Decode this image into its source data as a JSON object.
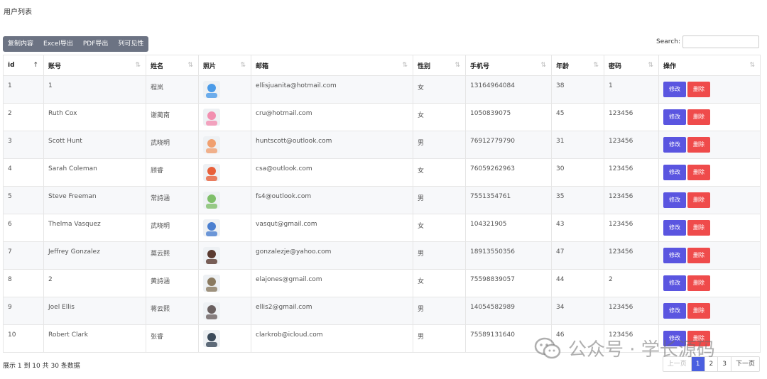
{
  "page": {
    "title": "用户列表"
  },
  "toolbar": {
    "buttons": [
      "复制内容",
      "Excel导出",
      "PDF导出",
      "列可见性"
    ]
  },
  "search": {
    "label": "Search:",
    "value": ""
  },
  "table": {
    "columns": [
      "id",
      "账号",
      "姓名",
      "照片",
      "邮箱",
      "性别",
      "手机号",
      "年龄",
      "密码",
      "操作"
    ],
    "edit_label": "修改",
    "delete_label": "删除",
    "rows": [
      {
        "id": "1",
        "account": "1",
        "name": "程岚",
        "email": "ellisjuanita@hotmail.com",
        "gender": "女",
        "phone": "13164964084",
        "age": "38",
        "password": "1",
        "avatar_color": "#4b9be8"
      },
      {
        "id": "2",
        "account": "Ruth Cox",
        "name": "谢蔺南",
        "email": "cru@hotmail.com",
        "gender": "女",
        "phone": "1050839075",
        "age": "45",
        "password": "123456",
        "avatar_color": "#f28fb0"
      },
      {
        "id": "3",
        "account": "Scott Hunt",
        "name": "武晓明",
        "email": "huntscott@outlook.com",
        "gender": "男",
        "phone": "76912779790",
        "age": "31",
        "password": "123456",
        "avatar_color": "#f0a070"
      },
      {
        "id": "4",
        "account": "Sarah Coleman",
        "name": "顾睿",
        "email": "csa@outlook.com",
        "gender": "女",
        "phone": "76059262963",
        "age": "30",
        "password": "123456",
        "avatar_color": "#e8603a"
      },
      {
        "id": "5",
        "account": "Steve Freeman",
        "name": "常詩涵",
        "email": "fs4@outlook.com",
        "gender": "男",
        "phone": "7551354761",
        "age": "35",
        "password": "123456",
        "avatar_color": "#7fbf6a"
      },
      {
        "id": "6",
        "account": "Thelma Vasquez",
        "name": "武晓明",
        "email": "vasqut@gmail.com",
        "gender": "女",
        "phone": "104321905",
        "age": "43",
        "password": "123456",
        "avatar_color": "#4a7fd0"
      },
      {
        "id": "7",
        "account": "Jeffrey Gonzalez",
        "name": "莫云熙",
        "email": "gonzalezje@yahoo.com",
        "gender": "男",
        "phone": "18913550356",
        "age": "47",
        "password": "123456",
        "avatar_color": "#5a3a30"
      },
      {
        "id": "8",
        "account": "2",
        "name": "黄詩涵",
        "email": "elajones@gmail.com",
        "gender": "女",
        "phone": "75598839057",
        "age": "44",
        "password": "2",
        "avatar_color": "#8a7a60"
      },
      {
        "id": "9",
        "account": "Joel Ellis",
        "name": "蒋云熙",
        "email": "ellis2@gmail.com",
        "gender": "男",
        "phone": "14054582989",
        "age": "34",
        "password": "123456",
        "avatar_color": "#6a6060"
      },
      {
        "id": "10",
        "account": "Robert Clark",
        "name": "张睿",
        "email": "clarkrob@icloud.com",
        "gender": "男",
        "phone": "75589131640",
        "age": "46",
        "password": "123456",
        "avatar_color": "#3a4a5a"
      }
    ]
  },
  "footer": {
    "info": "展示 1 到 10 共 30 条数据"
  },
  "pagination": {
    "prev": "上一页",
    "pages": [
      "1",
      "2",
      "3"
    ],
    "active_page": "1",
    "next": "下一页"
  },
  "watermark": {
    "text": "公众号 · 学长源码"
  }
}
